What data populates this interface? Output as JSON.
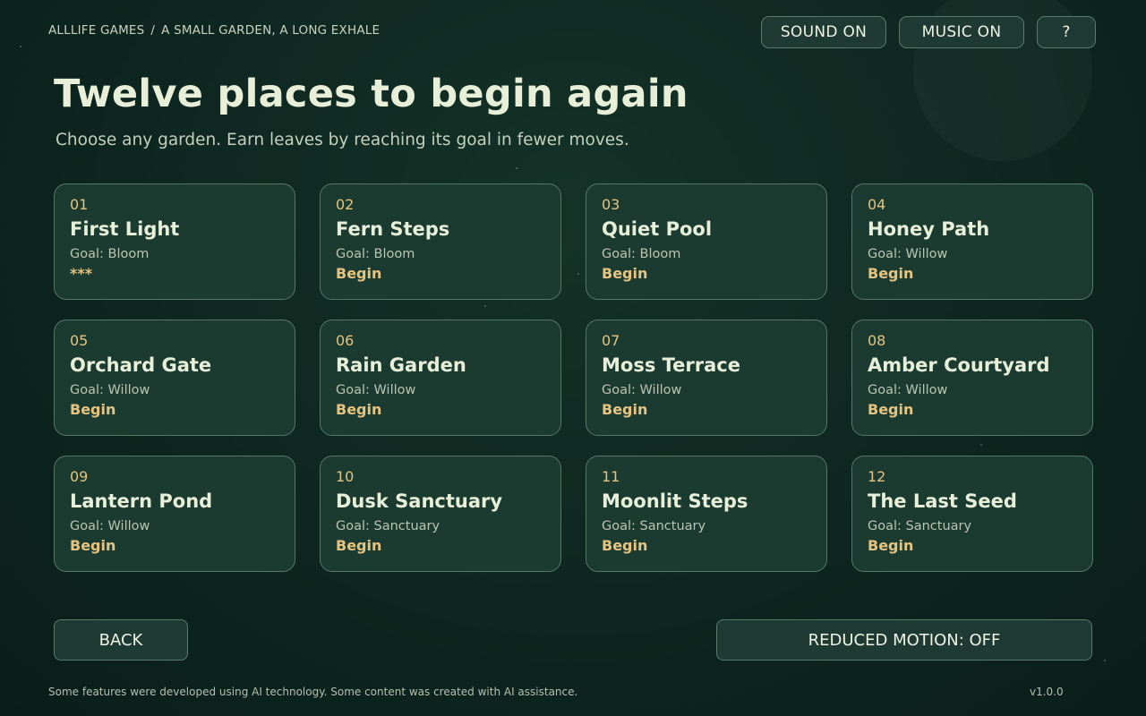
{
  "breadcrumb": {
    "studio": "ALLLIFE GAMES",
    "separator": "/",
    "game": "A SMALL GARDEN, A LONG EXHALE"
  },
  "top_buttons": {
    "sound": "SOUND ON",
    "music": "MUSIC ON",
    "help": "?"
  },
  "title": "Twelve places to begin again",
  "subtitle": "Choose any garden. Earn leaves by reaching its goal in fewer moves.",
  "levels": [
    {
      "num": "01",
      "name": "First Light",
      "goal": "Goal: Bloom",
      "action": "***"
    },
    {
      "num": "02",
      "name": "Fern Steps",
      "goal": "Goal: Bloom",
      "action": "Begin"
    },
    {
      "num": "03",
      "name": "Quiet Pool",
      "goal": "Goal: Bloom",
      "action": "Begin"
    },
    {
      "num": "04",
      "name": "Honey Path",
      "goal": "Goal: Willow",
      "action": "Begin"
    },
    {
      "num": "05",
      "name": "Orchard Gate",
      "goal": "Goal: Willow",
      "action": "Begin"
    },
    {
      "num": "06",
      "name": "Rain Garden",
      "goal": "Goal: Willow",
      "action": "Begin"
    },
    {
      "num": "07",
      "name": "Moss Terrace",
      "goal": "Goal: Willow",
      "action": "Begin"
    },
    {
      "num": "08",
      "name": "Amber Courtyard",
      "goal": "Goal: Willow",
      "action": "Begin"
    },
    {
      "num": "09",
      "name": "Lantern Pond",
      "goal": "Goal: Willow",
      "action": "Begin"
    },
    {
      "num": "10",
      "name": "Dusk Sanctuary",
      "goal": "Goal: Sanctuary",
      "action": "Begin"
    },
    {
      "num": "11",
      "name": "Moonlit Steps",
      "goal": "Goal: Sanctuary",
      "action": "Begin"
    },
    {
      "num": "12",
      "name": "The Last Seed",
      "goal": "Goal: Sanctuary",
      "action": "Begin"
    }
  ],
  "bottom": {
    "back": "BACK",
    "reduced_motion": "REDUCED MOTION: OFF"
  },
  "footer": {
    "disclaimer": "Some features were developed using AI technology. Some content was created with AI assistance.",
    "version": "v1.0.0"
  },
  "colors": {
    "background": "#0f2821",
    "card": "#1b3b31",
    "accent": "#e6c380",
    "text": "#e8efd9"
  }
}
